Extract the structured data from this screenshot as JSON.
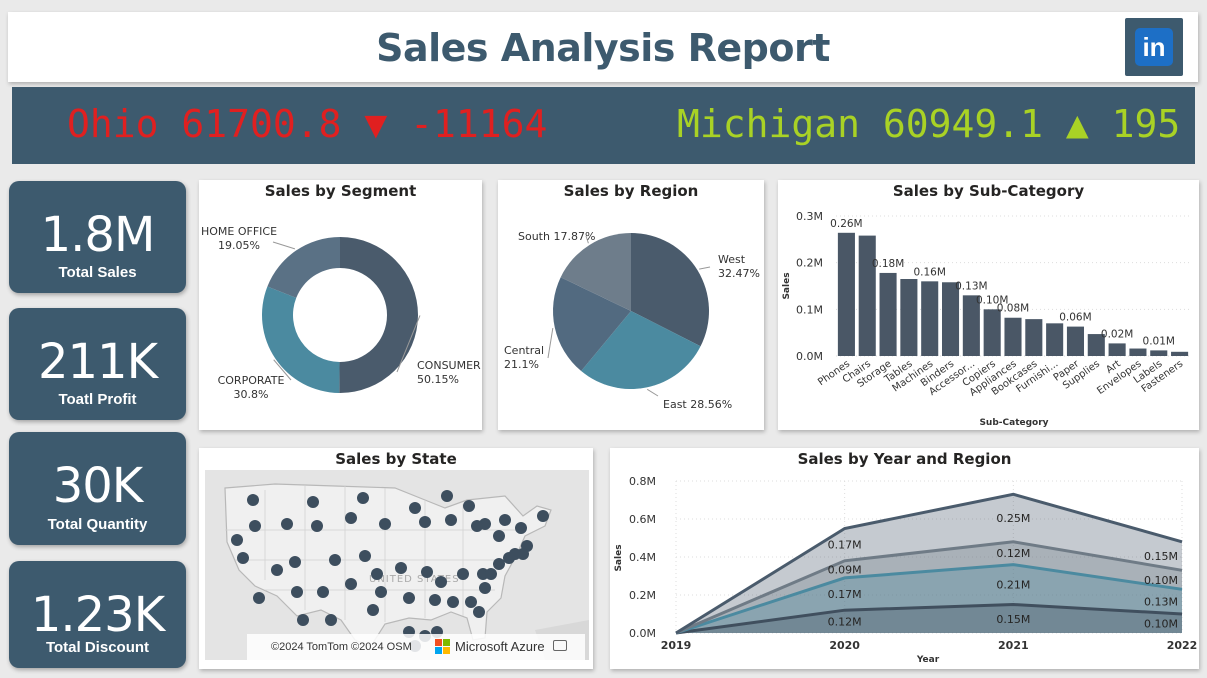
{
  "header": {
    "title": "Sales Analysis Report",
    "linkedin_label": "in"
  },
  "ticker": [
    {
      "text": "Ohio 61700.8 ▼ -11164",
      "color": "#e02020"
    },
    {
      "text": "Michigan 60949.1 ▲ 195",
      "color": "#a9d225"
    }
  ],
  "kpis": [
    {
      "value": "1.8M",
      "label": "Total Sales"
    },
    {
      "value": "211K",
      "label": "Toatl Profit"
    },
    {
      "value": "30K",
      "label": "Total Quantity"
    },
    {
      "value": "1.23K",
      "label": "Total Discount"
    }
  ],
  "segment_chart": {
    "title": "Sales by Segment"
  },
  "region_chart": {
    "title": "Sales by Region"
  },
  "subcat_chart": {
    "title": "Sales by Sub-Category"
  },
  "state_map": {
    "title": "Sales by State",
    "country_label": "UNITED STATES",
    "credit": "©2024 TomTom ©2024 OSM",
    "brand": "Microsoft Azure"
  },
  "year_chart": {
    "title": "Sales by Year and Region"
  },
  "colors": {
    "accent": "#3d5a6e",
    "up": "#a9d225",
    "down": "#e02020"
  },
  "chart_data": [
    {
      "type": "pie",
      "title": "Sales by Segment",
      "donut": true,
      "categories": [
        "CONSUMER",
        "CORPORATE",
        "HOME OFFICE"
      ],
      "values": [
        50.15,
        30.8,
        19.05
      ],
      "labels": [
        "50.15%",
        "30.8%",
        "19.05%"
      ],
      "colors": [
        "#4a5b6c",
        "#4b8aa0",
        "#5a7185"
      ]
    },
    {
      "type": "pie",
      "title": "Sales by Region",
      "donut": false,
      "categories": [
        "West",
        "East",
        "Central",
        "South"
      ],
      "values": [
        32.47,
        28.56,
        21.1,
        17.87
      ],
      "labels": [
        "32.47%",
        "28.56%",
        "21.1%",
        "17.87%"
      ],
      "colors": [
        "#4a5b6c",
        "#4b8aa0",
        "#526a80",
        "#6e7d8b"
      ]
    },
    {
      "type": "bar",
      "title": "Sales by Sub-Category",
      "xlabel": "Sub-Category",
      "ylabel": "Sales",
      "categories": [
        "Phones",
        "Chairs",
        "Storage",
        "Tables",
        "Machines",
        "Binders",
        "Accessor...",
        "Copiers",
        "Appliances",
        "Bookcases",
        "Furnishi...",
        "Paper",
        "Supplies",
        "Art",
        "Envelopes",
        "Labels",
        "Fasteners"
      ],
      "values": [
        0.264,
        0.258,
        0.178,
        0.165,
        0.16,
        0.158,
        0.13,
        0.1,
        0.082,
        0.079,
        0.07,
        0.063,
        0.047,
        0.027,
        0.016,
        0.012,
        0.009
      ],
      "data_labels": [
        "0.26M",
        "",
        "0.18M",
        "",
        "0.16M",
        "",
        "0.13M",
        "0.10M",
        "0.08M",
        "",
        "",
        "0.06M",
        "",
        "0.02M",
        "",
        "0.01M",
        ""
      ],
      "yticks": [
        "0.0M",
        "0.1M",
        "0.2M",
        "0.3M"
      ],
      "ylim": [
        0,
        0.3
      ],
      "color": "#4a5766"
    },
    {
      "type": "area",
      "title": "Sales by Year and Region",
      "xlabel": "Year",
      "ylabel": "Sales",
      "x": [
        "2019",
        "2020",
        "2021",
        "2022"
      ],
      "stacked": true,
      "series": [
        {
          "values": [
            0.0,
            0.12,
            0.15,
            0.1
          ],
          "color": "#404f5e",
          "labels": [
            "",
            "0.12M",
            "0.15M",
            "0.10M"
          ]
        },
        {
          "values": [
            0.0,
            0.17,
            0.21,
            0.13
          ],
          "color": "#4b8aa0",
          "labels": [
            "",
            "0.17M",
            "0.21M",
            "0.13M"
          ]
        },
        {
          "values": [
            0.0,
            0.09,
            0.12,
            0.1
          ],
          "color": "#6f7b86",
          "labels": [
            "",
            "0.09M",
            "0.12M",
            "0.10M"
          ]
        },
        {
          "values": [
            0.0,
            0.17,
            0.25,
            0.15
          ],
          "color": "#4a5b6c",
          "labels": [
            "",
            "0.17M",
            "0.25M",
            "0.15M"
          ]
        }
      ],
      "yticks": [
        "0.0M",
        "0.2M",
        "0.4M",
        "0.6M",
        "0.8M"
      ],
      "ylim": [
        0,
        0.8
      ]
    }
  ]
}
